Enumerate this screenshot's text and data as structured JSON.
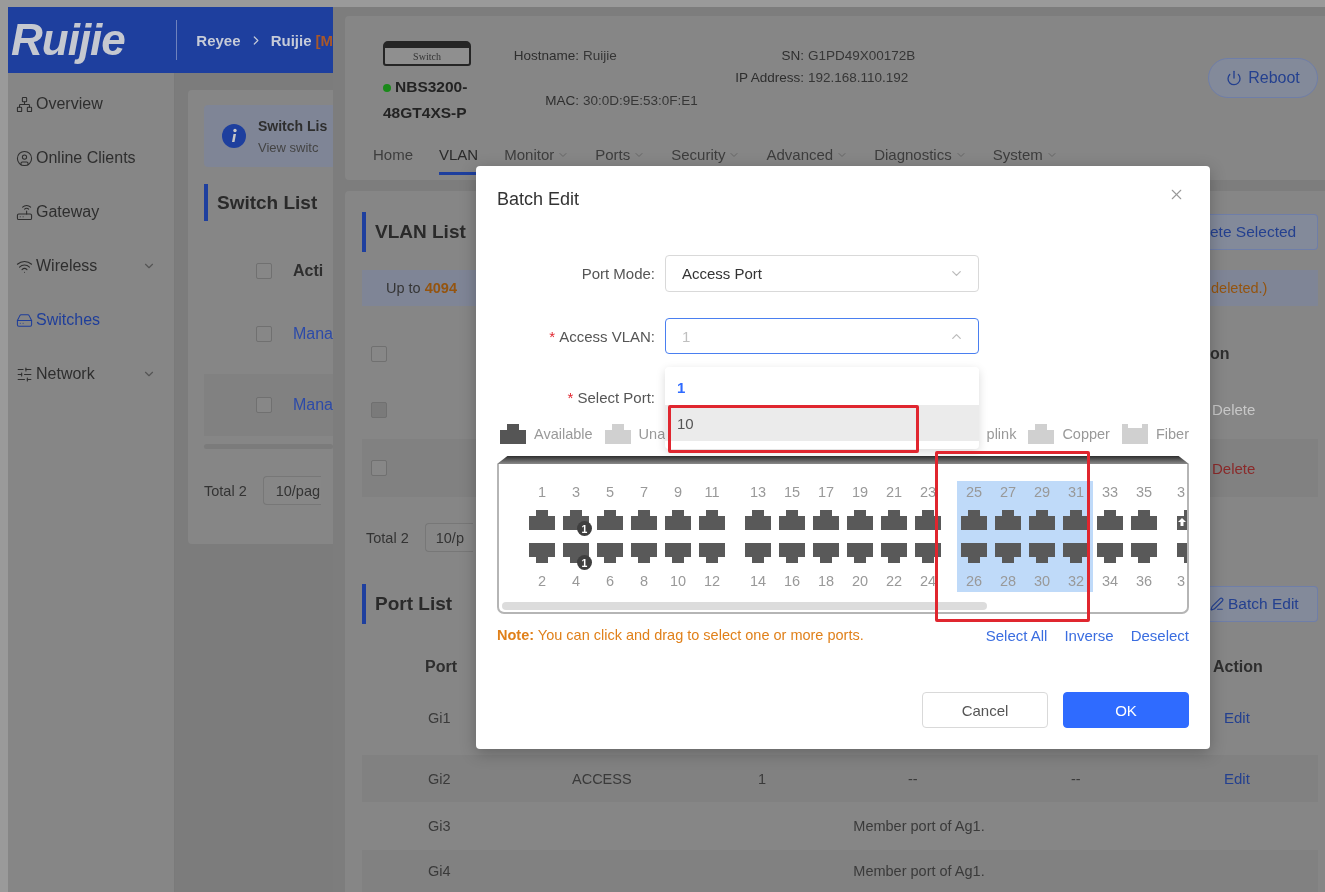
{
  "app": {
    "logo": "Ruijie",
    "breadcrumb": [
      "Reyee",
      "Ruijie"
    ],
    "breadcrumb_tag": "[M"
  },
  "sidebar": {
    "items": [
      {
        "label": "Overview",
        "selected": false,
        "expandable": false
      },
      {
        "label": "Online Clients",
        "selected": false,
        "expandable": false
      },
      {
        "label": "Gateway",
        "selected": false,
        "expandable": false
      },
      {
        "label": "Wireless",
        "selected": false,
        "expandable": true
      },
      {
        "label": "Switches",
        "selected": true,
        "expandable": false
      },
      {
        "label": "Network",
        "selected": false,
        "expandable": true
      }
    ]
  },
  "switch_list": {
    "info_title": "Switch Lis",
    "info_text": "View switc",
    "title": "Switch List",
    "header_checked": false,
    "header": "Acti",
    "rows": [
      {
        "checked": false,
        "link": "Mana"
      },
      {
        "checked": false,
        "link": "Mana"
      }
    ],
    "total": "Total 2",
    "page_size": "10/pag"
  },
  "device": {
    "image_label": "Switch",
    "online": true,
    "model": "NBS3200-48GT4XS-P",
    "fields": [
      {
        "label": "Hostname:",
        "value": "Ruijie"
      },
      {
        "label": "SN:",
        "value": "G1PD49X00172B"
      },
      {
        "label": "IP Address:",
        "value": "192.168.110.192"
      },
      {
        "label": "MAC:",
        "value": "30:0D:9E:53:0F:E1"
      }
    ],
    "reboot": "Reboot"
  },
  "tabs": [
    {
      "label": "Home",
      "selected": false,
      "menu": false
    },
    {
      "label": "VLAN",
      "selected": true,
      "menu": false
    },
    {
      "label": "Monitor",
      "selected": false,
      "menu": true
    },
    {
      "label": "Ports",
      "selected": false,
      "menu": true
    },
    {
      "label": "Security",
      "selected": false,
      "menu": true
    },
    {
      "label": "Advanced",
      "selected": false,
      "menu": true
    },
    {
      "label": "Diagnostics",
      "selected": false,
      "menu": true
    },
    {
      "label": "System",
      "selected": false,
      "menu": true
    }
  ],
  "vlan_list": {
    "title": "VLAN List",
    "delete_button": "ete Selected",
    "notice": "Up to **4094**",
    "notice_end": "deleted.)",
    "header_checked": false,
    "header_action": "on",
    "rows": [
      {
        "checked": false,
        "disabled": true,
        "action": "Delete"
      },
      {
        "checked": false,
        "disabled": false,
        "action": "Delete"
      }
    ],
    "total": "Total 2",
    "page_size": "10/p"
  },
  "port_list": {
    "title": "Port List",
    "batch_button": "Batch Edit",
    "header_port": "Port",
    "header_action": "Action",
    "rows": [
      {
        "kind": "covered",
        "port": "Gi1",
        "action": "Edit"
      },
      {
        "kind": "access",
        "port": "Gi2",
        "mode": "ACCESS",
        "vlan": "1",
        "column_4": "--",
        "column_5": "--",
        "action": "Edit"
      },
      {
        "kind": "member",
        "port": "Gi3",
        "note": "Member port of Ag1."
      },
      {
        "kind": "member",
        "port": "Gi4",
        "note": "Member port of Ag1."
      }
    ]
  },
  "modal": {
    "title": "Batch Edit",
    "fields": [
      {
        "label": "Port Mode:",
        "value": "Access Port",
        "open": false
      },
      {
        "mark": "*",
        "label": "Access VLAN:",
        "value": "1",
        "open": true
      },
      {
        "mark": "*",
        "label": "Select Port:"
      }
    ],
    "options": [
      {
        "label": "1",
        "selected": true,
        "hovered": false
      },
      {
        "label": "10",
        "selected": false,
        "hovered": true
      }
    ],
    "legend_left": [
      {
        "kind": "available",
        "label": "Available"
      },
      {
        "kind": "unavailable",
        "label": "Una"
      }
    ],
    "legend_right": [
      {
        "kind": "hidden",
        "label": "plink"
      },
      {
        "kind": "copper",
        "label": "Copper"
      },
      {
        "kind": "fiber",
        "label": "Fiber"
      }
    ],
    "port_groups": [
      {
        "partial": false,
        "ports": [
          {
            "label": "1",
            "kind": "copper",
            "selected": false
          },
          {
            "label": "2",
            "kind": "copper",
            "selected": false
          },
          {
            "label": "3",
            "kind": "copper",
            "selected": false,
            "badge": "1"
          },
          {
            "label": "4",
            "kind": "copper",
            "selected": false,
            "badge": "1"
          },
          {
            "label": "5",
            "kind": "copper",
            "selected": false
          },
          {
            "label": "6",
            "kind": "copper",
            "selected": false
          },
          {
            "label": "7",
            "kind": "copper",
            "selected": false
          },
          {
            "label": "8",
            "kind": "copper",
            "selected": false
          },
          {
            "label": "9",
            "kind": "copper",
            "selected": false
          },
          {
            "label": "10",
            "kind": "copper",
            "selected": false
          },
          {
            "label": "11",
            "kind": "copper",
            "selected": false
          },
          {
            "label": "12",
            "kind": "copper",
            "selected": false
          }
        ]
      },
      {
        "partial": false,
        "ports": [
          {
            "label": "13",
            "kind": "copper",
            "selected": false
          },
          {
            "label": "14",
            "kind": "copper",
            "selected": false
          },
          {
            "label": "15",
            "kind": "copper",
            "selected": false
          },
          {
            "label": "16",
            "kind": "copper",
            "selected": false
          },
          {
            "label": "17",
            "kind": "copper",
            "selected": false
          },
          {
            "label": "18",
            "kind": "copper",
            "selected": false
          },
          {
            "label": "19",
            "kind": "copper",
            "selected": false
          },
          {
            "label": "20",
            "kind": "copper",
            "selected": false
          },
          {
            "label": "21",
            "kind": "copper",
            "selected": false
          },
          {
            "label": "22",
            "kind": "copper",
            "selected": false
          },
          {
            "label": "23",
            "kind": "copper",
            "selected": false
          },
          {
            "label": "24",
            "kind": "copper",
            "selected": false
          }
        ]
      },
      {
        "partial": false,
        "ports": [
          {
            "label": "25",
            "kind": "copper",
            "selected": true
          },
          {
            "label": "26",
            "kind": "copper",
            "selected": true
          },
          {
            "label": "27",
            "kind": "copper",
            "selected": true
          },
          {
            "label": "28",
            "kind": "copper",
            "selected": true
          },
          {
            "label": "29",
            "kind": "copper",
            "selected": true
          },
          {
            "label": "30",
            "kind": "copper",
            "selected": true
          },
          {
            "label": "31",
            "kind": "copper",
            "selected": true
          },
          {
            "label": "32",
            "kind": "copper",
            "selected": true
          },
          {
            "label": "33",
            "kind": "copper",
            "selected": false
          },
          {
            "label": "34",
            "kind": "copper",
            "selected": false
          },
          {
            "label": "35",
            "kind": "copper",
            "selected": false
          },
          {
            "label": "36",
            "kind": "copper",
            "selected": false
          }
        ]
      },
      {
        "partial": true,
        "ports": [
          {
            "label": "3",
            "kind": "uplink",
            "selected": false
          },
          {
            "label": "3",
            "kind": "copper",
            "selected": false
          }
        ]
      }
    ],
    "note": "**Note:** You can click and drag to select one or more ports.",
    "links": [
      "Select All",
      "Inverse",
      "Deselect"
    ],
    "buttons": [
      {
        "kind": "default",
        "label": "Cancel"
      },
      {
        "kind": "primary",
        "label": "OK"
      }
    ]
  }
}
